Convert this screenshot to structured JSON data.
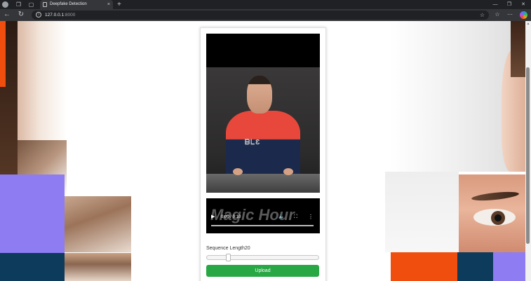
{
  "browser": {
    "tab_title": "Deepfake Detection",
    "tab_close": "×",
    "new_tab": "+",
    "url_host": "127.0.0.1",
    "url_port": ":8000",
    "window_controls": [
      "—",
      "❐",
      "✕"
    ]
  },
  "video_controls": {
    "play": "▶",
    "time": "0:00 / 0:10",
    "volume": "🔈",
    "fullscreen": "⛶",
    "more": "⋮",
    "progress": 0
  },
  "video_watermark": "Magic Hour",
  "shirt_print": "ᗷᒪƐ",
  "form": {
    "sequence_label": "Sequence Length",
    "sequence_value": "20",
    "upload_label": "Upload"
  },
  "colors": {
    "upload_button": "#28a745",
    "accent_orange": "#f04e0f",
    "accent_purple": "#8e7cf3",
    "accent_navy": "#0c3b5c"
  }
}
